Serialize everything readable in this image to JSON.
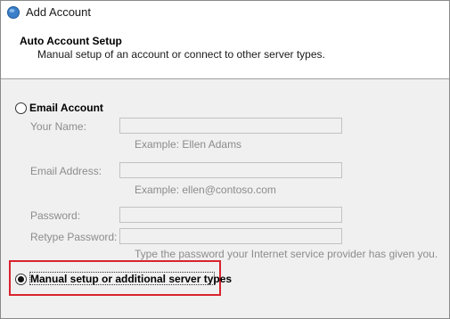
{
  "window": {
    "title": "Add Account",
    "icon": "outlook-app-icon"
  },
  "header": {
    "title": "Auto Account Setup",
    "subtitle": "Manual setup of an account or connect to other server types."
  },
  "email_account": {
    "label": "Email Account",
    "selected": false,
    "fields": {
      "name": {
        "label": "Your Name:",
        "value": "",
        "hint": "Example: Ellen Adams"
      },
      "email": {
        "label": "Email Address:",
        "value": "",
        "hint": "Example: ellen@contoso.com"
      },
      "password": {
        "label": "Password:",
        "value": ""
      },
      "retype": {
        "label": "Retype Password:",
        "value": "",
        "hint": "Type the password your Internet service provider has given you."
      }
    }
  },
  "manual_setup": {
    "label": "Manual setup or additional server types",
    "selected": true
  },
  "colors": {
    "highlight": "#d9232e",
    "disabled_text": "#8c8c8c",
    "panel_bg": "#f0f0f0"
  }
}
